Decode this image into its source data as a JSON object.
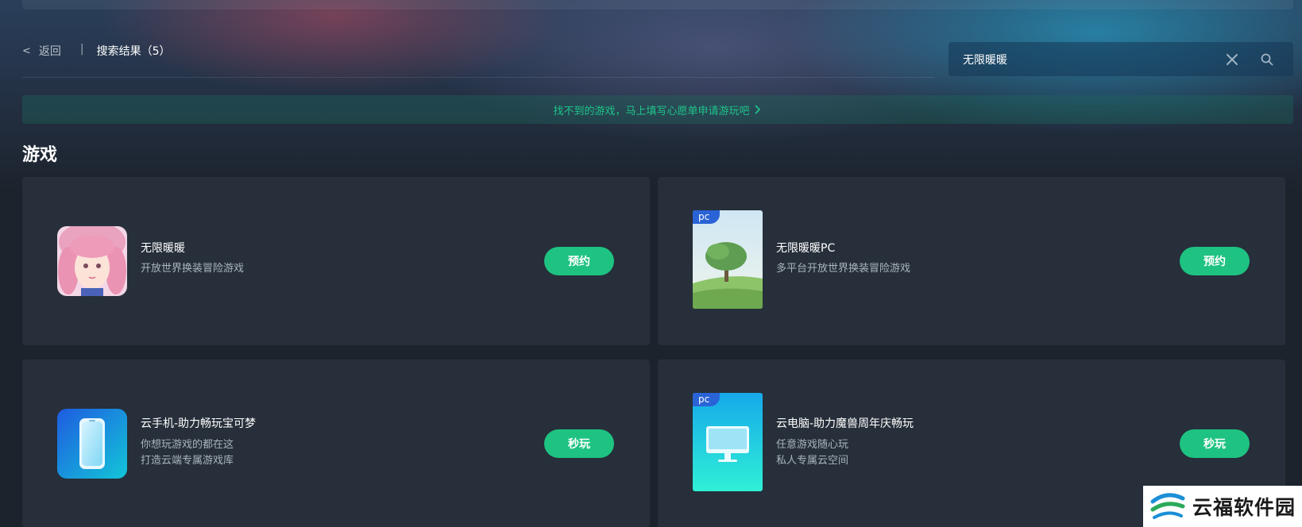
{
  "nav": {
    "back_label": "返回",
    "separator": "|",
    "result_title": "搜索结果（5）"
  },
  "search": {
    "value": "无限暖暖",
    "icons": [
      "close-icon",
      "search-icon"
    ]
  },
  "wish_banner": {
    "text": "找不到的游戏，马上填写心愿单申请游玩吧",
    "icon": "chevron-right-icon"
  },
  "section": {
    "title": "游戏"
  },
  "games": [
    {
      "name": "无限暖暖",
      "desc_lines": [
        "开放世界换装冒险游戏"
      ],
      "button": "预约",
      "badge": ""
    },
    {
      "name": "无限暖暖PC",
      "desc_lines": [
        "多平台开放世界换装冒险游戏"
      ],
      "button": "预约",
      "badge": "pc"
    },
    {
      "name": "云手机-助力畅玩宝可梦",
      "desc_lines": [
        "你想玩游戏的都在这",
        "打造云端专属游戏库"
      ],
      "button": "秒玩",
      "badge": ""
    },
    {
      "name": "云电脑-助力魔兽周年庆畅玩",
      "desc_lines": [
        "任意游戏随心玩",
        "私人专属云空间"
      ],
      "button": "秒玩",
      "badge": "pc"
    }
  ],
  "watermark": {
    "text": "云福软件园"
  },
  "colors": {
    "accent": "#1ec381",
    "card_bg": "#262f3a",
    "page_bg": "#1c232c",
    "pc_badge": "#2a63d6"
  }
}
